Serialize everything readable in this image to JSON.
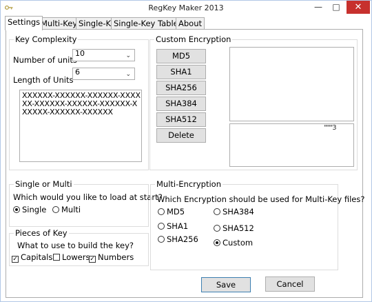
{
  "window": {
    "title": "RegKey Maker 2013"
  },
  "tabs": [
    {
      "label": "Settings",
      "active": true
    },
    {
      "label": "Multi-Key"
    },
    {
      "label": "Single-Key"
    },
    {
      "label": "Single-Key Table"
    },
    {
      "label": "About"
    }
  ],
  "key_complexity": {
    "title": "Key Complexity",
    "number_of_units_label": "Number of units",
    "number_of_units_value": "10",
    "length_of_units_label": "Length of Units",
    "length_of_units_value": "6",
    "preview_lines": [
      "XXXXXX-XXXXXX-XXXXXX-XXXX",
      "XX-XXXXXX-XXXXXX-XXXXXX-X",
      "XXXXX-XXXXXX-XXXXXX"
    ]
  },
  "custom_encryption": {
    "title": "Custom Encryption",
    "buttons": [
      "MD5",
      "SHA1",
      "SHA256",
      "SHA384",
      "SHA512",
      "Delete"
    ],
    "output_fragment": "'''''''3"
  },
  "single_or_multi": {
    "title": "Single or Multi",
    "question": "Which would you like to load at start?",
    "options": [
      {
        "label": "Single",
        "selected": true
      },
      {
        "label": "Multi",
        "selected": false
      }
    ]
  },
  "pieces_of_key": {
    "title": "Pieces of Key",
    "question": "What to use to build the key?",
    "options": [
      {
        "label": "Capitals",
        "checked": true
      },
      {
        "label": "Lowers",
        "checked": false
      },
      {
        "label": "Numbers",
        "checked": true
      }
    ]
  },
  "multi_encryption": {
    "title": "Multi-Encryption",
    "question": "Which Encryption should be used for Multi-Key files?",
    "options": [
      {
        "label": "MD5",
        "selected": false
      },
      {
        "label": "SHA384",
        "selected": false
      },
      {
        "label": "SHA1",
        "selected": false
      },
      {
        "label": "SHA512",
        "selected": false
      },
      {
        "label": "SHA256",
        "selected": false
      },
      {
        "label": "Custom",
        "selected": true
      }
    ]
  },
  "footer": {
    "save_label": "Save",
    "cancel_label": "Cancel"
  },
  "icons": {
    "app": "key-icon",
    "minimize": "minimize-icon",
    "maximize": "maximize-icon",
    "close": "close-icon",
    "dropdown": "chevron-down-icon"
  },
  "colors": {
    "close_button": "#c7312e",
    "default_button_border": "#3c7fb1"
  }
}
